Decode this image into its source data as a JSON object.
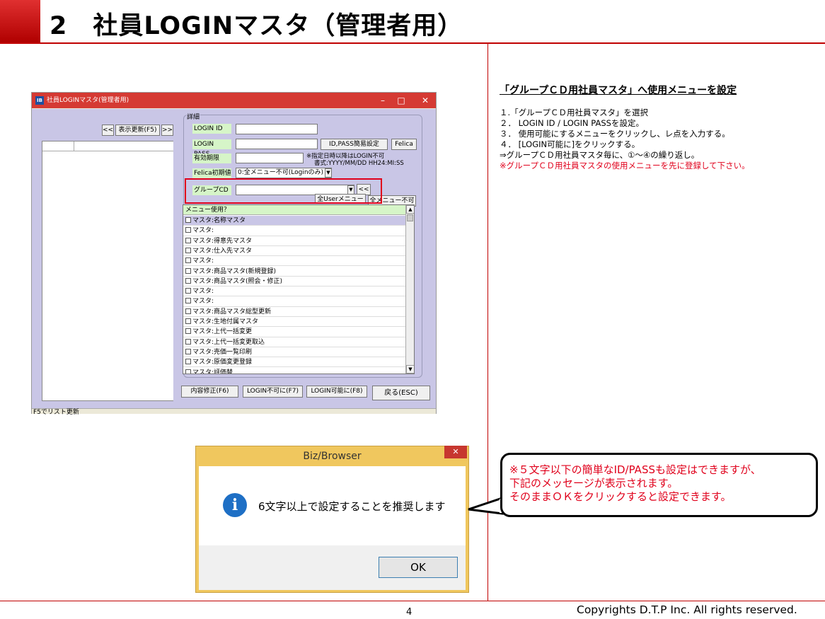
{
  "page": {
    "title": "2　社員LOGINマスタ（管理者用）",
    "page_number": "4",
    "copyright": "Copyrights  D.T.P Inc. All rights reserved."
  },
  "app_window": {
    "title": "社員LOGINマスタ(管理者用)",
    "app_icon": "IB",
    "controls": {
      "minimize": "–",
      "maximize": "□",
      "close": "✕"
    },
    "left": {
      "prev_btn": "<<",
      "refresh_btn": "表示更新(F5)",
      "next_btn": ">>"
    },
    "detail": {
      "legend": "詳細",
      "login_id_label": "LOGIN ID",
      "login_pass_label": "LOGIN PASS",
      "id_pass_easy_btn": "ID,PASS簡易設定",
      "felica_btn": "Felica",
      "expiry_label": "有効期限",
      "expiry_note_1": "※指定日時以降はLOGIN不可",
      "expiry_note_2": "書式:YYYY/MM/DD HH24:MI:SS",
      "felica_init_label": "Felica初期値",
      "felica_init_value": "0:全メニュー不可(Loginのみ)",
      "group_cd_label": "グループCD",
      "group_cd_value": "",
      "group_back_btn": "<<",
      "all_user_menu_btn": "全Userメニュー",
      "all_menu_disable_btn": "全メニュー不可"
    },
    "menu_list": {
      "header": "メニュー使用？",
      "items": [
        "マスタ:名称マスタ",
        "マスタ:",
        "マスタ:得意先マスタ",
        "マスタ:仕入先マスタ",
        "マスタ:",
        "マスタ:商品マスタ(新規登録)",
        "マスタ:商品マスタ(照会・修正)",
        "マスタ:",
        "マスタ:",
        "マスタ:商品マスタ総型更新",
        "マスタ:生地付属マスタ",
        "マスタ:上代一括変更",
        "マスタ:上代一括変更取込",
        "マスタ:売価一覧印刷",
        "マスタ:原価変更登録",
        "マスタ:評価替"
      ]
    },
    "buttons": {
      "edit": "内容修正(F6)",
      "login_disable": "LOGIN不可に(F7)",
      "login_enable": "LOGIN可能に(F8)",
      "back": "戻る(ESC)"
    },
    "status_text": "F5でリスト更新"
  },
  "instructions": {
    "heading": "「グループＣＤ用社員マスタ」へ使用メニューを設定",
    "steps": [
      "１.「グループＣＤ用社員マスタ」を選択",
      "２．  LOGIN ID / LOGIN PASSを設定。",
      "３．  使用可能にするメニューをクリックし、レ点を入力する。",
      "４．  [LOGIN可能に]をクリックする。",
      "⇒グループＣＤ用社員マスタ毎に、①～④の繰り返し。"
    ],
    "warning": "※グループＣＤ用社員マスタの使用メニューを先に登録して下さい。"
  },
  "dialog": {
    "title": "Biz/Browser",
    "close": "✕",
    "icon": "i",
    "message": "6文字以上で設定することを推奨します",
    "ok_label": "OK"
  },
  "callout": {
    "line1": "※５文字以下の簡単なID/PASSも設定はできますが、",
    "line2": "下記のメッセージが表示されます。",
    "line3": "そのままＯＫをクリックすると設定できます。"
  },
  "colors": {
    "accent": "#c00000",
    "warning": "#e0001b",
    "window_titlebar": "#d53a33",
    "pane_bg": "#c9c6e6",
    "label_bg": "#d6f5c8"
  }
}
